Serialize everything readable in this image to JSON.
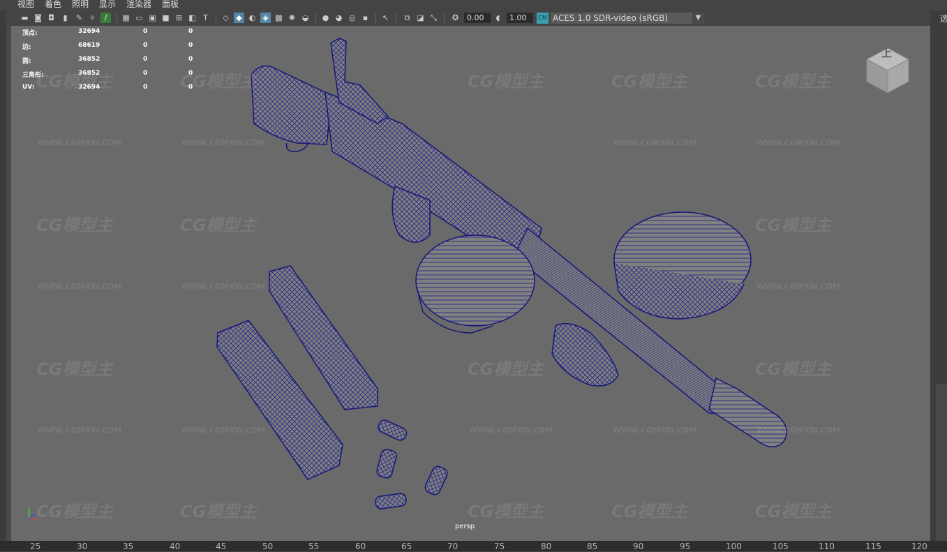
{
  "menu": [
    "视图",
    "着色",
    "照明",
    "显示",
    "渲染器",
    "面板"
  ],
  "toolbar": {
    "exposure_value": "0.00",
    "gamma_value": "1.00",
    "color_space": "ACES 1.0 SDR-video (sRGB)",
    "color_space_dropdown_icon": "triangle-down"
  },
  "hud": {
    "rows": [
      {
        "label": "顶点:",
        "value": "32694",
        "sel": "0",
        "tris": "0"
      },
      {
        "label": "边:",
        "value": "68619",
        "sel": "0",
        "tris": "0"
      },
      {
        "label": "面:",
        "value": "36852",
        "sel": "0",
        "tris": "0"
      },
      {
        "label": "三角形:",
        "value": "36852",
        "sel": "0",
        "tris": "0"
      },
      {
        "label": "UV:",
        "value": "32694",
        "sel": "0",
        "tris": "0"
      }
    ]
  },
  "viewport": {
    "camera_label": "persp",
    "viewcube_face": "上",
    "watermark_logo": "CG模型主",
    "watermark_url": "WWW.CGMXW.COM"
  },
  "timeline": {
    "ticks": [
      "25",
      "30",
      "35",
      "40",
      "45",
      "50",
      "55",
      "60",
      "65",
      "70",
      "75",
      "80",
      "85",
      "90",
      "95",
      "100",
      "105",
      "110",
      "115",
      "120"
    ]
  },
  "side_panel_char": "选",
  "colors": {
    "viewport_bg": "#6a6a6a",
    "wireframe": "#1a1a8a",
    "mesh_fill": "#7f7f7f",
    "ui_bg": "#444444"
  }
}
